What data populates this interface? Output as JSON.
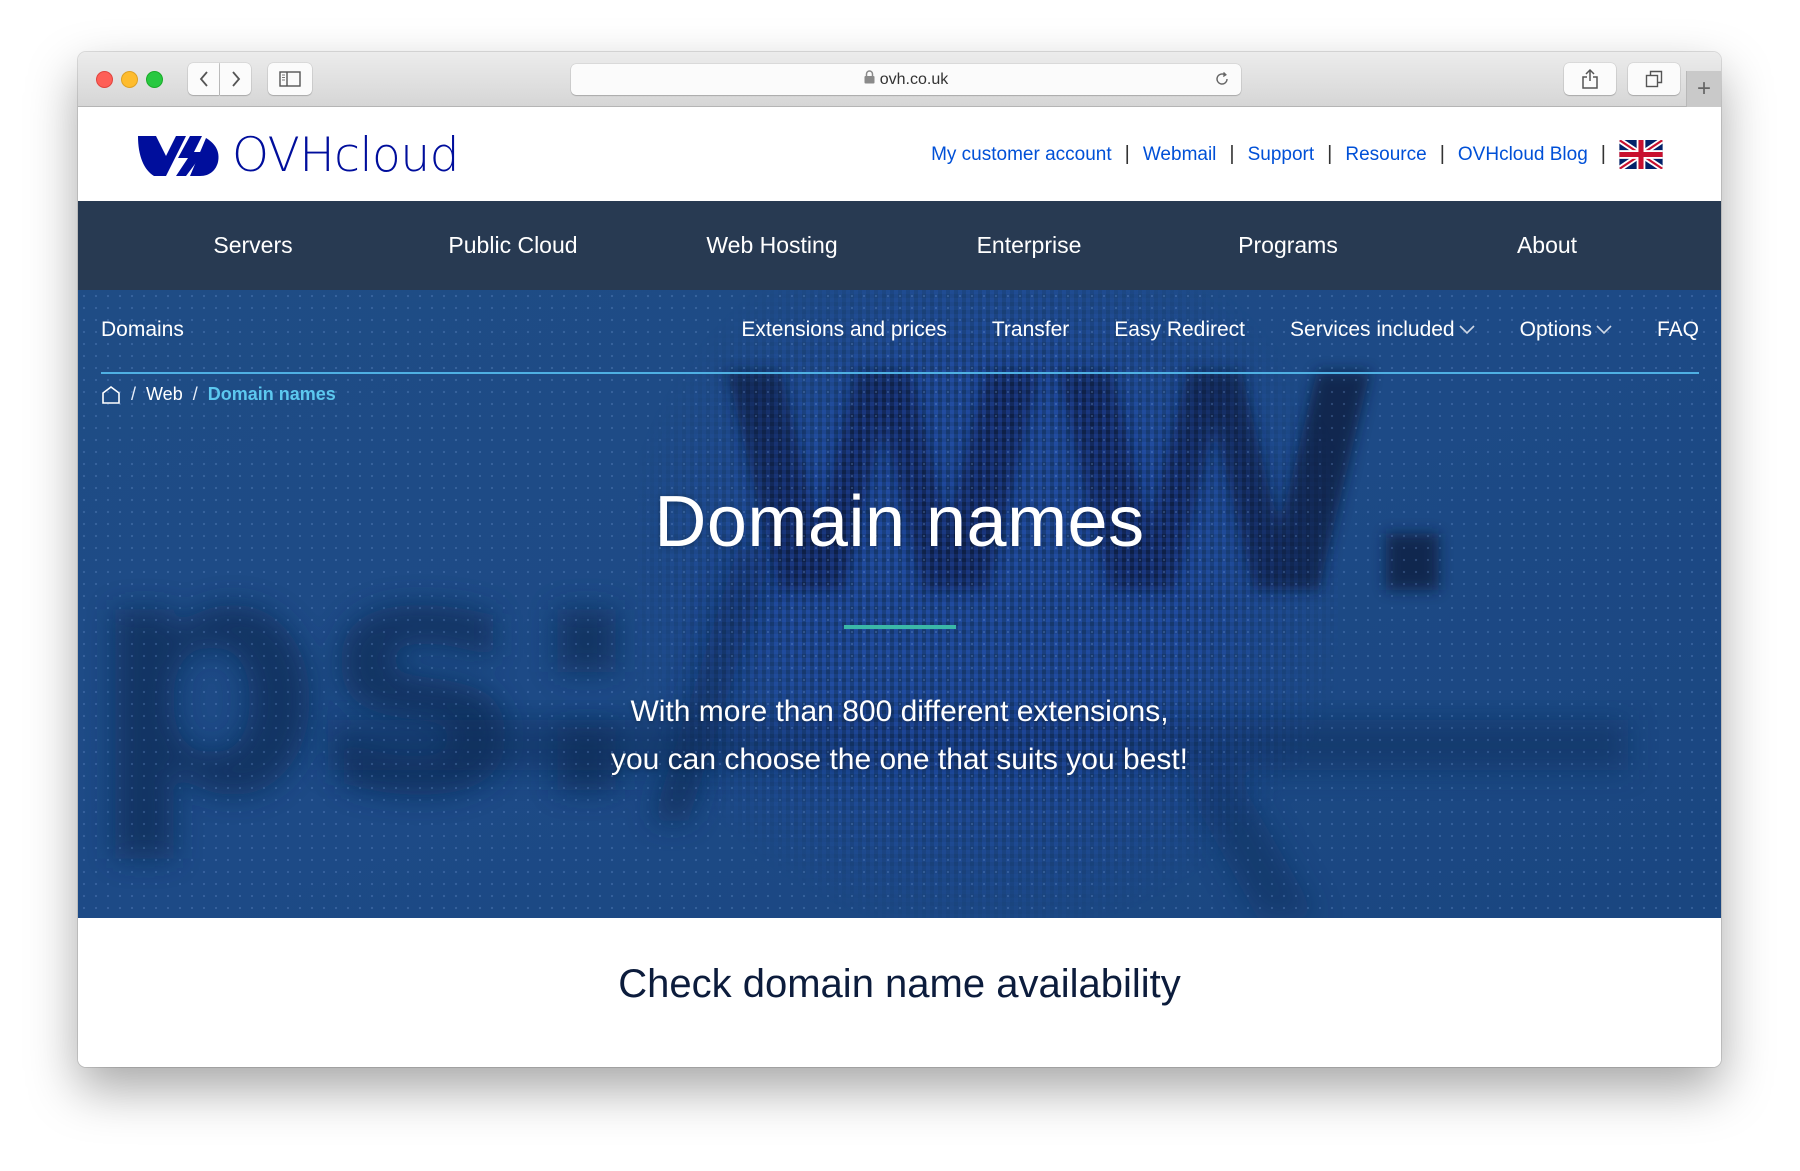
{
  "browser": {
    "url": "ovh.co.uk",
    "icons": {
      "back": "chevron-left-icon",
      "forward": "chevron-right-icon",
      "sidebar": "sidebar-icon",
      "lock": "lock-icon",
      "reload": "reload-icon",
      "share": "share-icon",
      "tabs": "tabs-icon",
      "new_tab": "plus-icon"
    },
    "new_tab_label": "+"
  },
  "header": {
    "logo_text": "OVHcloud",
    "brand_color": "#000e9c",
    "top_links": [
      {
        "label": "My customer account"
      },
      {
        "label": "Webmail"
      },
      {
        "label": "Support"
      },
      {
        "label": "Resource"
      },
      {
        "label": "OVHcloud Blog"
      }
    ],
    "separator": "|",
    "language_flag": "uk-flag-icon"
  },
  "main_nav": {
    "items": [
      {
        "label": "Servers"
      },
      {
        "label": "Public Cloud"
      },
      {
        "label": "Web Hosting"
      },
      {
        "label": "Enterprise"
      },
      {
        "label": "Programs"
      },
      {
        "label": "About"
      }
    ]
  },
  "sub_nav": {
    "section_title": "Domains",
    "items": [
      {
        "label": "Extensions and prices",
        "has_dropdown": false
      },
      {
        "label": "Transfer",
        "has_dropdown": false
      },
      {
        "label": "Easy Redirect",
        "has_dropdown": false
      },
      {
        "label": "Services included",
        "has_dropdown": true
      },
      {
        "label": "Options",
        "has_dropdown": true
      },
      {
        "label": "FAQ",
        "has_dropdown": false
      }
    ]
  },
  "breadcrumb": {
    "home_icon": "home-icon",
    "separator": "/",
    "items": [
      {
        "label": "Web"
      },
      {
        "label": "Domain names",
        "current": true
      }
    ]
  },
  "hero": {
    "title": "Domain names",
    "subtitle_line1": "With more than 800 different extensions,",
    "subtitle_line2": "you can choose the one that suits you best!",
    "accent_color": "#3bb8a8"
  },
  "availability": {
    "heading": "Check domain name availability",
    "input_value": "",
    "button_accent": "#5ecfec",
    "button_fill_fraction": 0.5
  }
}
